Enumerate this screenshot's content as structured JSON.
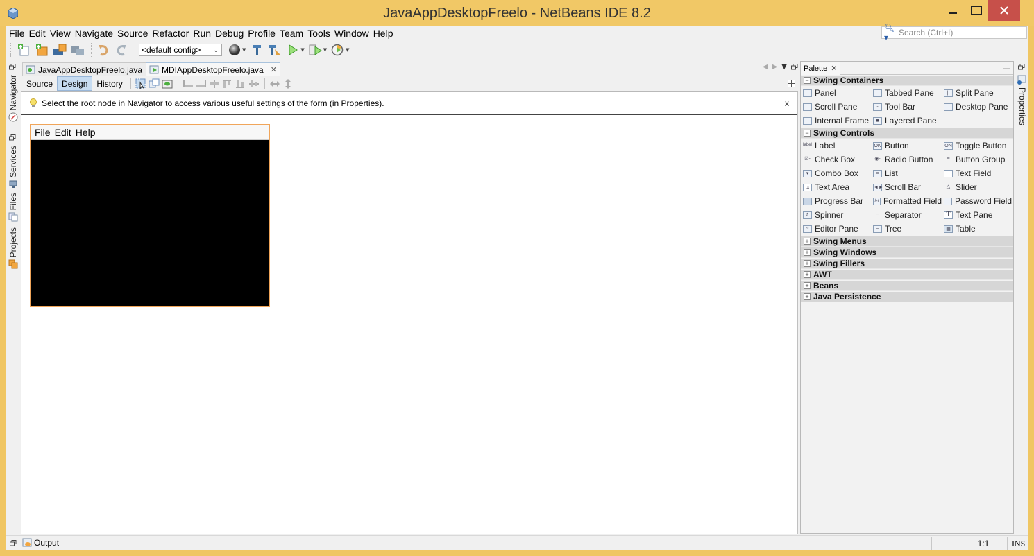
{
  "window": {
    "title": "JavaAppDesktopFreelo - NetBeans IDE 8.2",
    "accent_color": "#f1c866",
    "close_color": "#c7504a"
  },
  "menubar": {
    "items": [
      "File",
      "Edit",
      "View",
      "Navigate",
      "Source",
      "Refactor",
      "Run",
      "Debug",
      "Profile",
      "Team",
      "Tools",
      "Window",
      "Help"
    ]
  },
  "search": {
    "placeholder": "Search (Ctrl+I)"
  },
  "toolbar": {
    "config_value": "<default config>",
    "buttons": [
      "new-file",
      "new-project",
      "open-project",
      "close-project",
      "undo",
      "redo",
      "browser",
      "build",
      "clean-build",
      "run",
      "debug",
      "profile"
    ]
  },
  "left_sidebar": {
    "tabs": [
      "Navigator",
      "Services",
      "Files",
      "Projects"
    ]
  },
  "editor": {
    "tabs": [
      {
        "label": "JavaAppDesktopFreelo.java",
        "active": false
      },
      {
        "label": "MDIAppDesktopFreelo.java",
        "active": true
      }
    ],
    "modes": [
      "Source",
      "Design",
      "History"
    ],
    "active_mode": "Design",
    "hint": "Select the root node in Navigator to access various useful settings of the form (in Properties).",
    "hint_close": "x",
    "form": {
      "menus": [
        "File",
        "Edit",
        "Help"
      ],
      "background": "#000000"
    }
  },
  "palette": {
    "tab_label": "Palette",
    "categories": [
      {
        "name": "Swing Containers",
        "expanded": true,
        "items": [
          "Panel",
          "Tabbed Pane",
          "Split Pane",
          "Scroll Pane",
          "Tool Bar",
          "Desktop Pane",
          "Internal Frame",
          "Layered Pane"
        ]
      },
      {
        "name": "Swing Controls",
        "expanded": true,
        "items": [
          "Label",
          "Button",
          "Toggle Button",
          "Check Box",
          "Radio Button",
          "Button Group",
          "Combo Box",
          "List",
          "Text Field",
          "Text Area",
          "Scroll Bar",
          "Slider",
          "Progress Bar",
          "Formatted Field",
          "Password Field",
          "Spinner",
          "Separator",
          "Text Pane",
          "Editor Pane",
          "Tree",
          "Table"
        ]
      },
      {
        "name": "Swing Menus",
        "expanded": false,
        "items": []
      },
      {
        "name": "Swing Windows",
        "expanded": false,
        "items": []
      },
      {
        "name": "Swing Fillers",
        "expanded": false,
        "items": []
      },
      {
        "name": "AWT",
        "expanded": false,
        "items": []
      },
      {
        "name": "Beans",
        "expanded": false,
        "items": []
      },
      {
        "name": "Java Persistence",
        "expanded": false,
        "items": []
      }
    ]
  },
  "right_sidebar": {
    "tabs": [
      "Properties"
    ]
  },
  "statusbar": {
    "output_label": "Output",
    "position": "1:1",
    "mode": "INS"
  }
}
